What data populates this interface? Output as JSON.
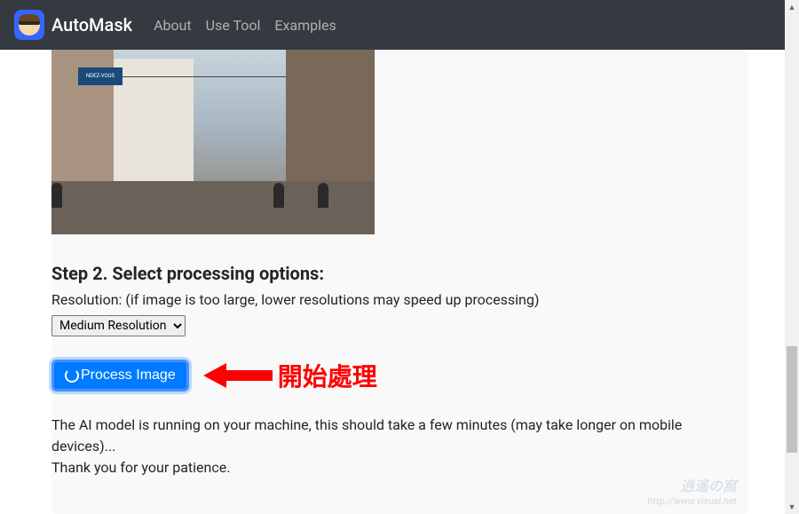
{
  "navbar": {
    "brand": "AutoMask",
    "links": [
      "About",
      "Use Tool",
      "Examples"
    ]
  },
  "step": {
    "heading": "Step 2. Select processing options:",
    "resolution_label": "Resolution: (if image is too large, lower resolutions may speed up processing)",
    "resolution_selected": "Medium Resolution",
    "process_button": "Process Image"
  },
  "annotation": {
    "text": "開始處理"
  },
  "status": {
    "line1": "The AI model is running on your machine, this should take a few minutes (may take longer on mobile devices)...",
    "line2": "Thank you for your patience."
  },
  "watermark": {
    "top": "逍遙の窩",
    "url": "http://www.vixual.net"
  }
}
